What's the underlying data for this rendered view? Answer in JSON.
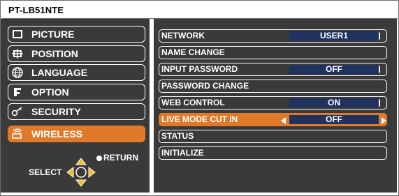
{
  "header": {
    "model": "PT-LB51NTE"
  },
  "sidebar": {
    "items": [
      {
        "label": "PICTURE",
        "icon": "picture-icon"
      },
      {
        "label": "POSITION",
        "icon": "position-icon"
      },
      {
        "label": "LANGUAGE",
        "icon": "language-globe-icon"
      },
      {
        "label": "OPTION",
        "icon": "option-icon"
      },
      {
        "label": "SECURITY",
        "icon": "security-key-icon"
      },
      {
        "label": "WIRELESS",
        "icon": "wireless-icon",
        "active": true
      }
    ],
    "hint": {
      "select": "SELECT",
      "return": "RETURN"
    }
  },
  "wireless_menu": {
    "rows": [
      {
        "label": "NETWORK",
        "value": "USER1"
      },
      {
        "label": "NAME CHANGE"
      },
      {
        "label": "INPUT PASSWORD",
        "value": "OFF"
      },
      {
        "label": "PASSWORD CHANGE"
      },
      {
        "label": "WEB CONTROL",
        "value": "ON"
      },
      {
        "label": "LIVE MODE CUT IN",
        "value": "OFF",
        "highlighted": true
      },
      {
        "label": "STATUS"
      },
      {
        "label": "INITIALIZE"
      }
    ]
  },
  "colors": {
    "panel": "#3a3a3a",
    "highlight": "#e07a2a",
    "value_field": "#1f3260",
    "text": "#ffffff"
  }
}
